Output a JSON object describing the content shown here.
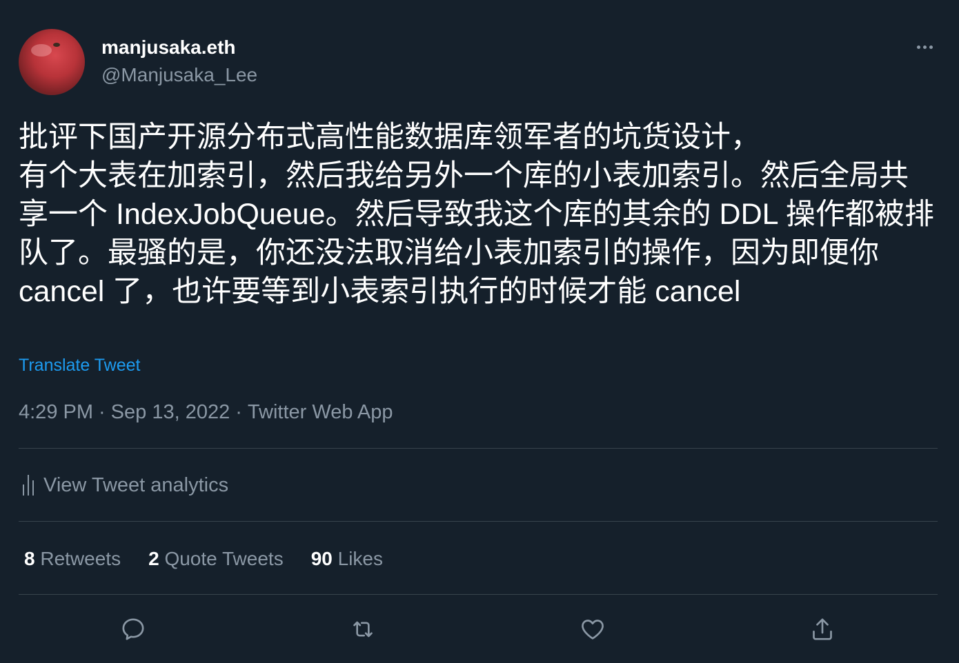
{
  "author": {
    "display_name": "manjusaka.eth",
    "handle": "@Manjusaka_Lee"
  },
  "tweet": {
    "text": "批评下国产开源分布式高性能数据库领军者的坑货设计，\n有个大表在加索引，然后我给另外一个库的小表加索引。然后全局共享一个 IndexJobQueue。然后导致我这个库的其余的 DDL 操作都被排队了。最骚的是，你还没法取消给小表加索引的操作，因为即便你 cancel 了，也许要等到小表索引执行的时候才能 cancel",
    "translate_label": "Translate Tweet"
  },
  "meta": {
    "time": "4:29 PM",
    "separator": "·",
    "date": "Sep 13, 2022",
    "source": "Twitter Web App"
  },
  "analytics": {
    "label": "View Tweet analytics"
  },
  "stats": {
    "retweets_count": "8",
    "retweets_label": "Retweets",
    "quotes_count": "2",
    "quotes_label": "Quote Tweets",
    "likes_count": "90",
    "likes_label": "Likes"
  },
  "icons": {
    "more": "more-horizontal-icon",
    "analytics": "bar-chart-icon",
    "reply": "reply-icon",
    "retweet": "retweet-icon",
    "like": "heart-icon",
    "share": "share-icon"
  },
  "colors": {
    "background": "#15202b",
    "text_primary": "#ffffff",
    "text_secondary": "#8b98a5",
    "accent": "#1d9bf0",
    "divider": "#38444d"
  }
}
